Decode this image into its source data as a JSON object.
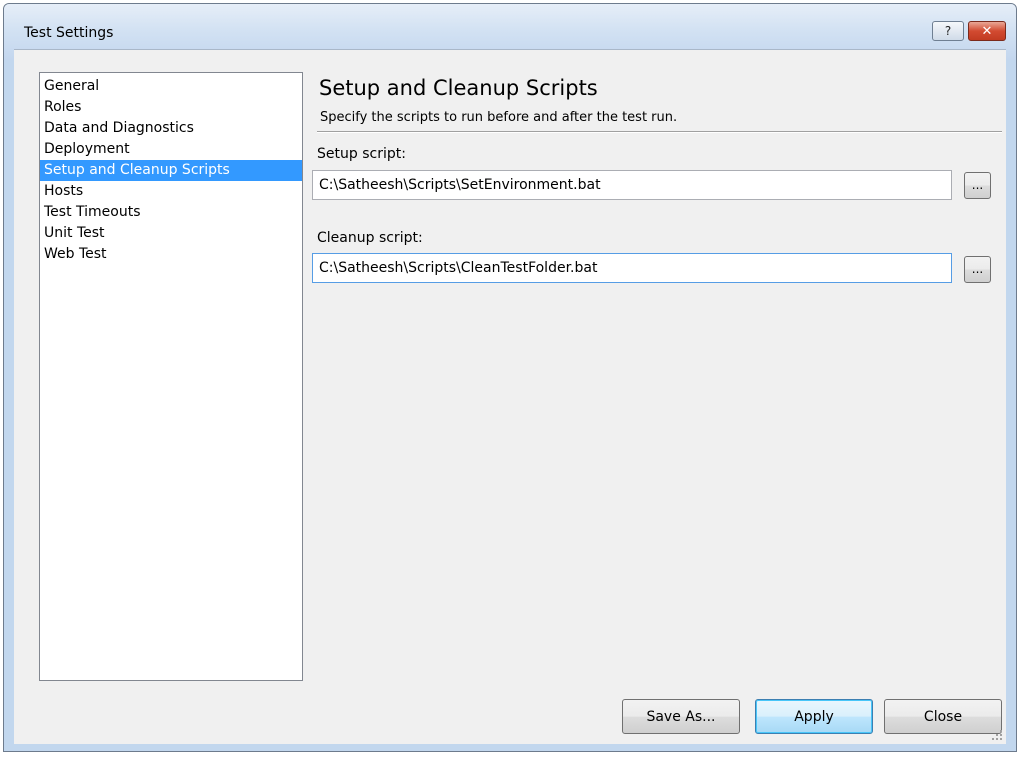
{
  "window": {
    "title": "Test Settings",
    "help_glyph": "?",
    "close_glyph": "✕"
  },
  "sidebar": {
    "items": [
      {
        "label": "General",
        "selected": false
      },
      {
        "label": "Roles",
        "selected": false
      },
      {
        "label": "Data and Diagnostics",
        "selected": false
      },
      {
        "label": "Deployment",
        "selected": false
      },
      {
        "label": "Setup and Cleanup Scripts",
        "selected": true
      },
      {
        "label": "Hosts",
        "selected": false
      },
      {
        "label": "Test Timeouts",
        "selected": false
      },
      {
        "label": "Unit Test",
        "selected": false
      },
      {
        "label": "Web Test",
        "selected": false
      }
    ]
  },
  "panel": {
    "title": "Setup and Cleanup Scripts",
    "subtitle": "Specify the scripts to run before and after the test run.",
    "setup": {
      "label": "Setup script:",
      "value": "C:\\Satheesh\\Scripts\\SetEnvironment.bat",
      "browse_label": "..."
    },
    "cleanup": {
      "label": "Cleanup script:",
      "value": "C:\\Satheesh\\Scripts\\CleanTestFolder.bat",
      "browse_label": "..."
    }
  },
  "footer": {
    "save_as_label": "Save As...",
    "apply_label": "Apply",
    "close_label": "Close"
  },
  "colors": {
    "selection": "#3399ff",
    "dialog_background": "#f0f0f0",
    "frame": "#c2d7ee"
  }
}
